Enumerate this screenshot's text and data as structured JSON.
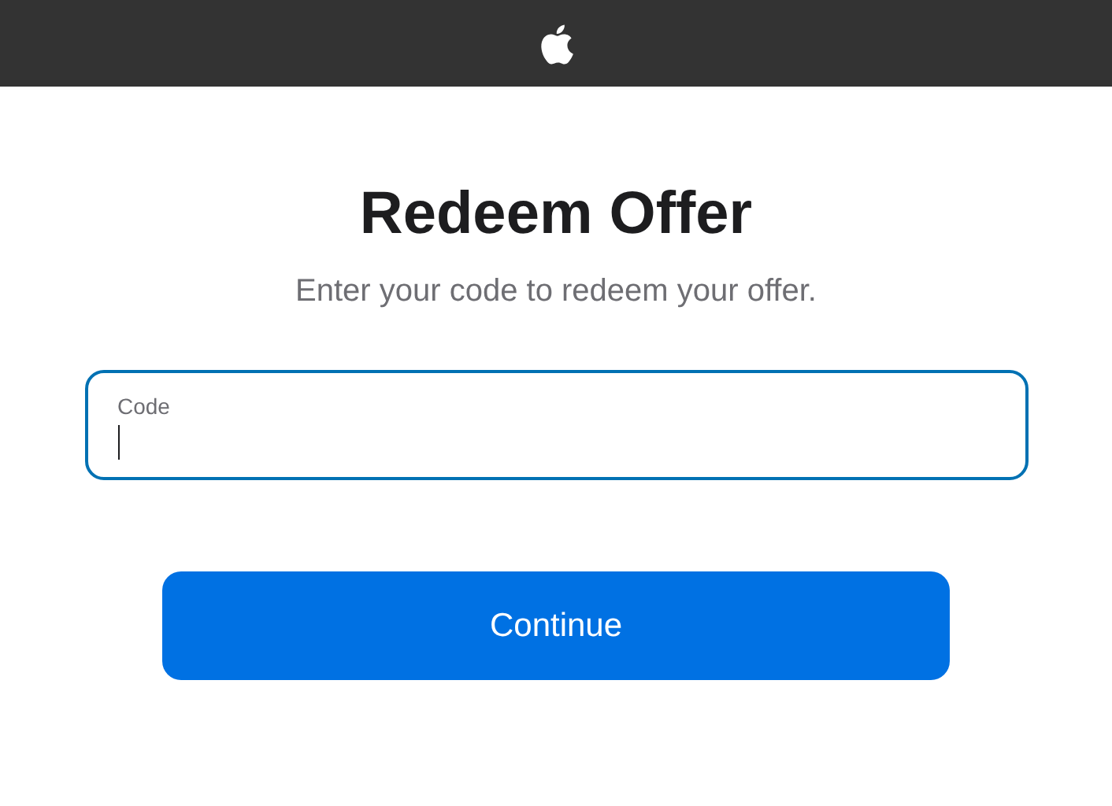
{
  "title": "Redeem Offer",
  "subtitle": "Enter your code to redeem your offer.",
  "code_field": {
    "label": "Code",
    "focused": true
  },
  "button": {
    "label": "Continue"
  }
}
